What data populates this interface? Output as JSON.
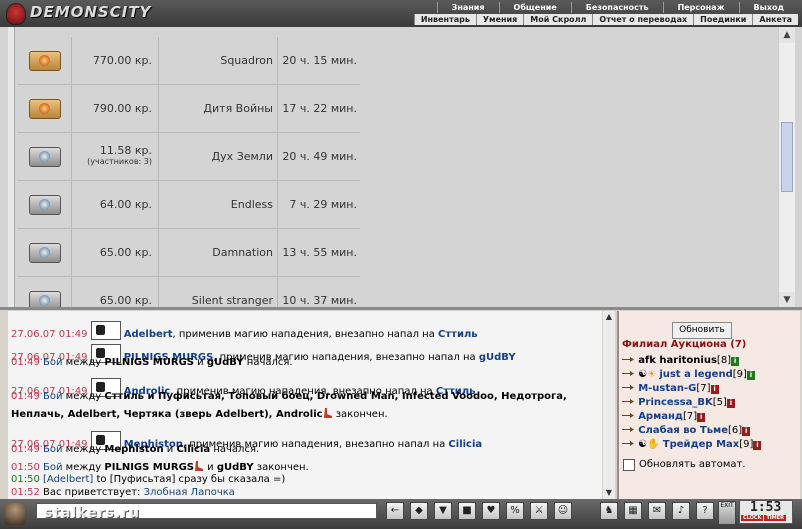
{
  "app": {
    "logo_text": "DEMONSCITY"
  },
  "menu_row1": [
    "Знания",
    "Общение",
    "Безопасность",
    "Персонаж",
    "Выход"
  ],
  "menu_row2": [
    "Инвентарь",
    "Умения",
    "Мой Скролл",
    "Отчет о переводах",
    "Поединки",
    "Анкета"
  ],
  "lots": [
    {
      "price": "770.00 кр.",
      "participants": "",
      "name": "Squadron",
      "time": "20 ч. 15 мин.",
      "icon": "gold-scroll-icon"
    },
    {
      "price": "790.00 кр.",
      "participants": "",
      "name": "Дитя Войны",
      "time": "17 ч. 22 мин.",
      "icon": "gold-scroll-icon"
    },
    {
      "price": "11.58 кр.",
      "participants": "(участников: 3)",
      "name": "Дух Земли",
      "time": "20 ч. 49 мин.",
      "icon": "silver-scroll-icon"
    },
    {
      "price": "64.00 кр.",
      "participants": "",
      "name": "Endless",
      "time": "7 ч. 29 мин.",
      "icon": "silver-scroll-icon"
    },
    {
      "price": "65.00 кр.",
      "participants": "",
      "name": "Damnation",
      "time": "13 ч. 55 мин.",
      "icon": "silver-scroll-icon"
    },
    {
      "price": "65.00 кр.",
      "participants": "",
      "name": "Silent stranger",
      "time": "10 ч. 37 мин.",
      "icon": "silver-scroll-icon"
    }
  ],
  "chat": {
    "lines": {
      "l1": {
        "time": "27.06.07 01:49",
        "name": "Adelbert",
        "text": ", применив магию нападения, внезапно напал на ",
        "target": "Сттиль"
      },
      "l2": {
        "time": "27.06.07 01:49",
        "name": "PILNIGS MURGS",
        "text": ", применив магию нападения, внезапно напал на ",
        "target": "gUdBY"
      },
      "l3": {
        "time": "01:49",
        "boy": "Бой",
        "between": " между ",
        "p1": "PILNIGS MURGS",
        "and": " и ",
        "p2": "gUdBY",
        "end": " начался."
      },
      "l4": {
        "time": "27.06.07 01:49",
        "name": "Androlic",
        "text": ", применив магию нападения, внезапно напал на ",
        "target": "Сттиль"
      },
      "l5": {
        "time": "01:49",
        "boy": "Бой",
        "between": " между ",
        "rest": "Сттиль и Пуфисьтая, Топовый боец, Drowned Man, Infected Voodoo, Недотрога,"
      },
      "l6": {
        "text": "Неплачь, Adelbert, Чертяка (зверь Adelbert), Androlic",
        "end": " закончен."
      },
      "l7": {
        "time": "27.06.07 01:49",
        "name": "Mephiston",
        "text": ", применив магию нападения, внезапно напал на ",
        "target": "Cilicia"
      },
      "l8": {
        "time": "01:49",
        "boy": "Бой",
        "between": " между ",
        "p1": "Mephiston",
        "and": " и ",
        "p2": "Cilicia",
        "end": " начался."
      },
      "l9": {
        "time": "01:50",
        "boy": "Бой",
        "between": " между ",
        "p1": "PILNIGS MURGS",
        "and": " и ",
        "p2": "gUdBY",
        "end": " закончен."
      },
      "l10": {
        "time": "01:50",
        "who": "[Adelbert]",
        "mid": " to ",
        "to": "[Пуфисьтая]",
        "text": " сразу бы сказала =)"
      },
      "l11": {
        "time": "01:52",
        "text": "Вас приветствует: ",
        "name": "Злобная Лапочка"
      }
    }
  },
  "right_panel": {
    "refresh_label": "Обновить",
    "branch_title": "Филиал Аукциона (7)",
    "users": [
      {
        "name": "afk haritonius",
        "level": "[8]",
        "info": "i"
      },
      {
        "name": "just a legend",
        "level": "[9]",
        "info": "i"
      },
      {
        "name": "M-ustan-G",
        "level": "[7]",
        "info": "i"
      },
      {
        "name": "Princessa_BK",
        "level": "[5]",
        "info": "i"
      },
      {
        "name": "Арманд",
        "level": "[7]",
        "info": "i"
      },
      {
        "name": "Слабая во Тьме",
        "level": "[6]",
        "info": "i"
      },
      {
        "name": "Трейдер Max",
        "level": "[9]",
        "info": "i"
      }
    ],
    "auto_refresh_label": "Обновлять автомат."
  },
  "bottom": {
    "input_value": "",
    "watermark": "stalkers.ru",
    "clock_time": "1:53",
    "clock_label": "CLOCK",
    "timer_label": "TIMER",
    "exit_label": "EXIT",
    "toolbar_buttons": [
      "←",
      "◆",
      "▼",
      "■",
      "♥",
      "%",
      "⚔",
      "☺"
    ]
  },
  "colors": {
    "accent_name": "#123f8a",
    "timestamp": "#c0384d",
    "system_time": "#1a7a1a"
  }
}
